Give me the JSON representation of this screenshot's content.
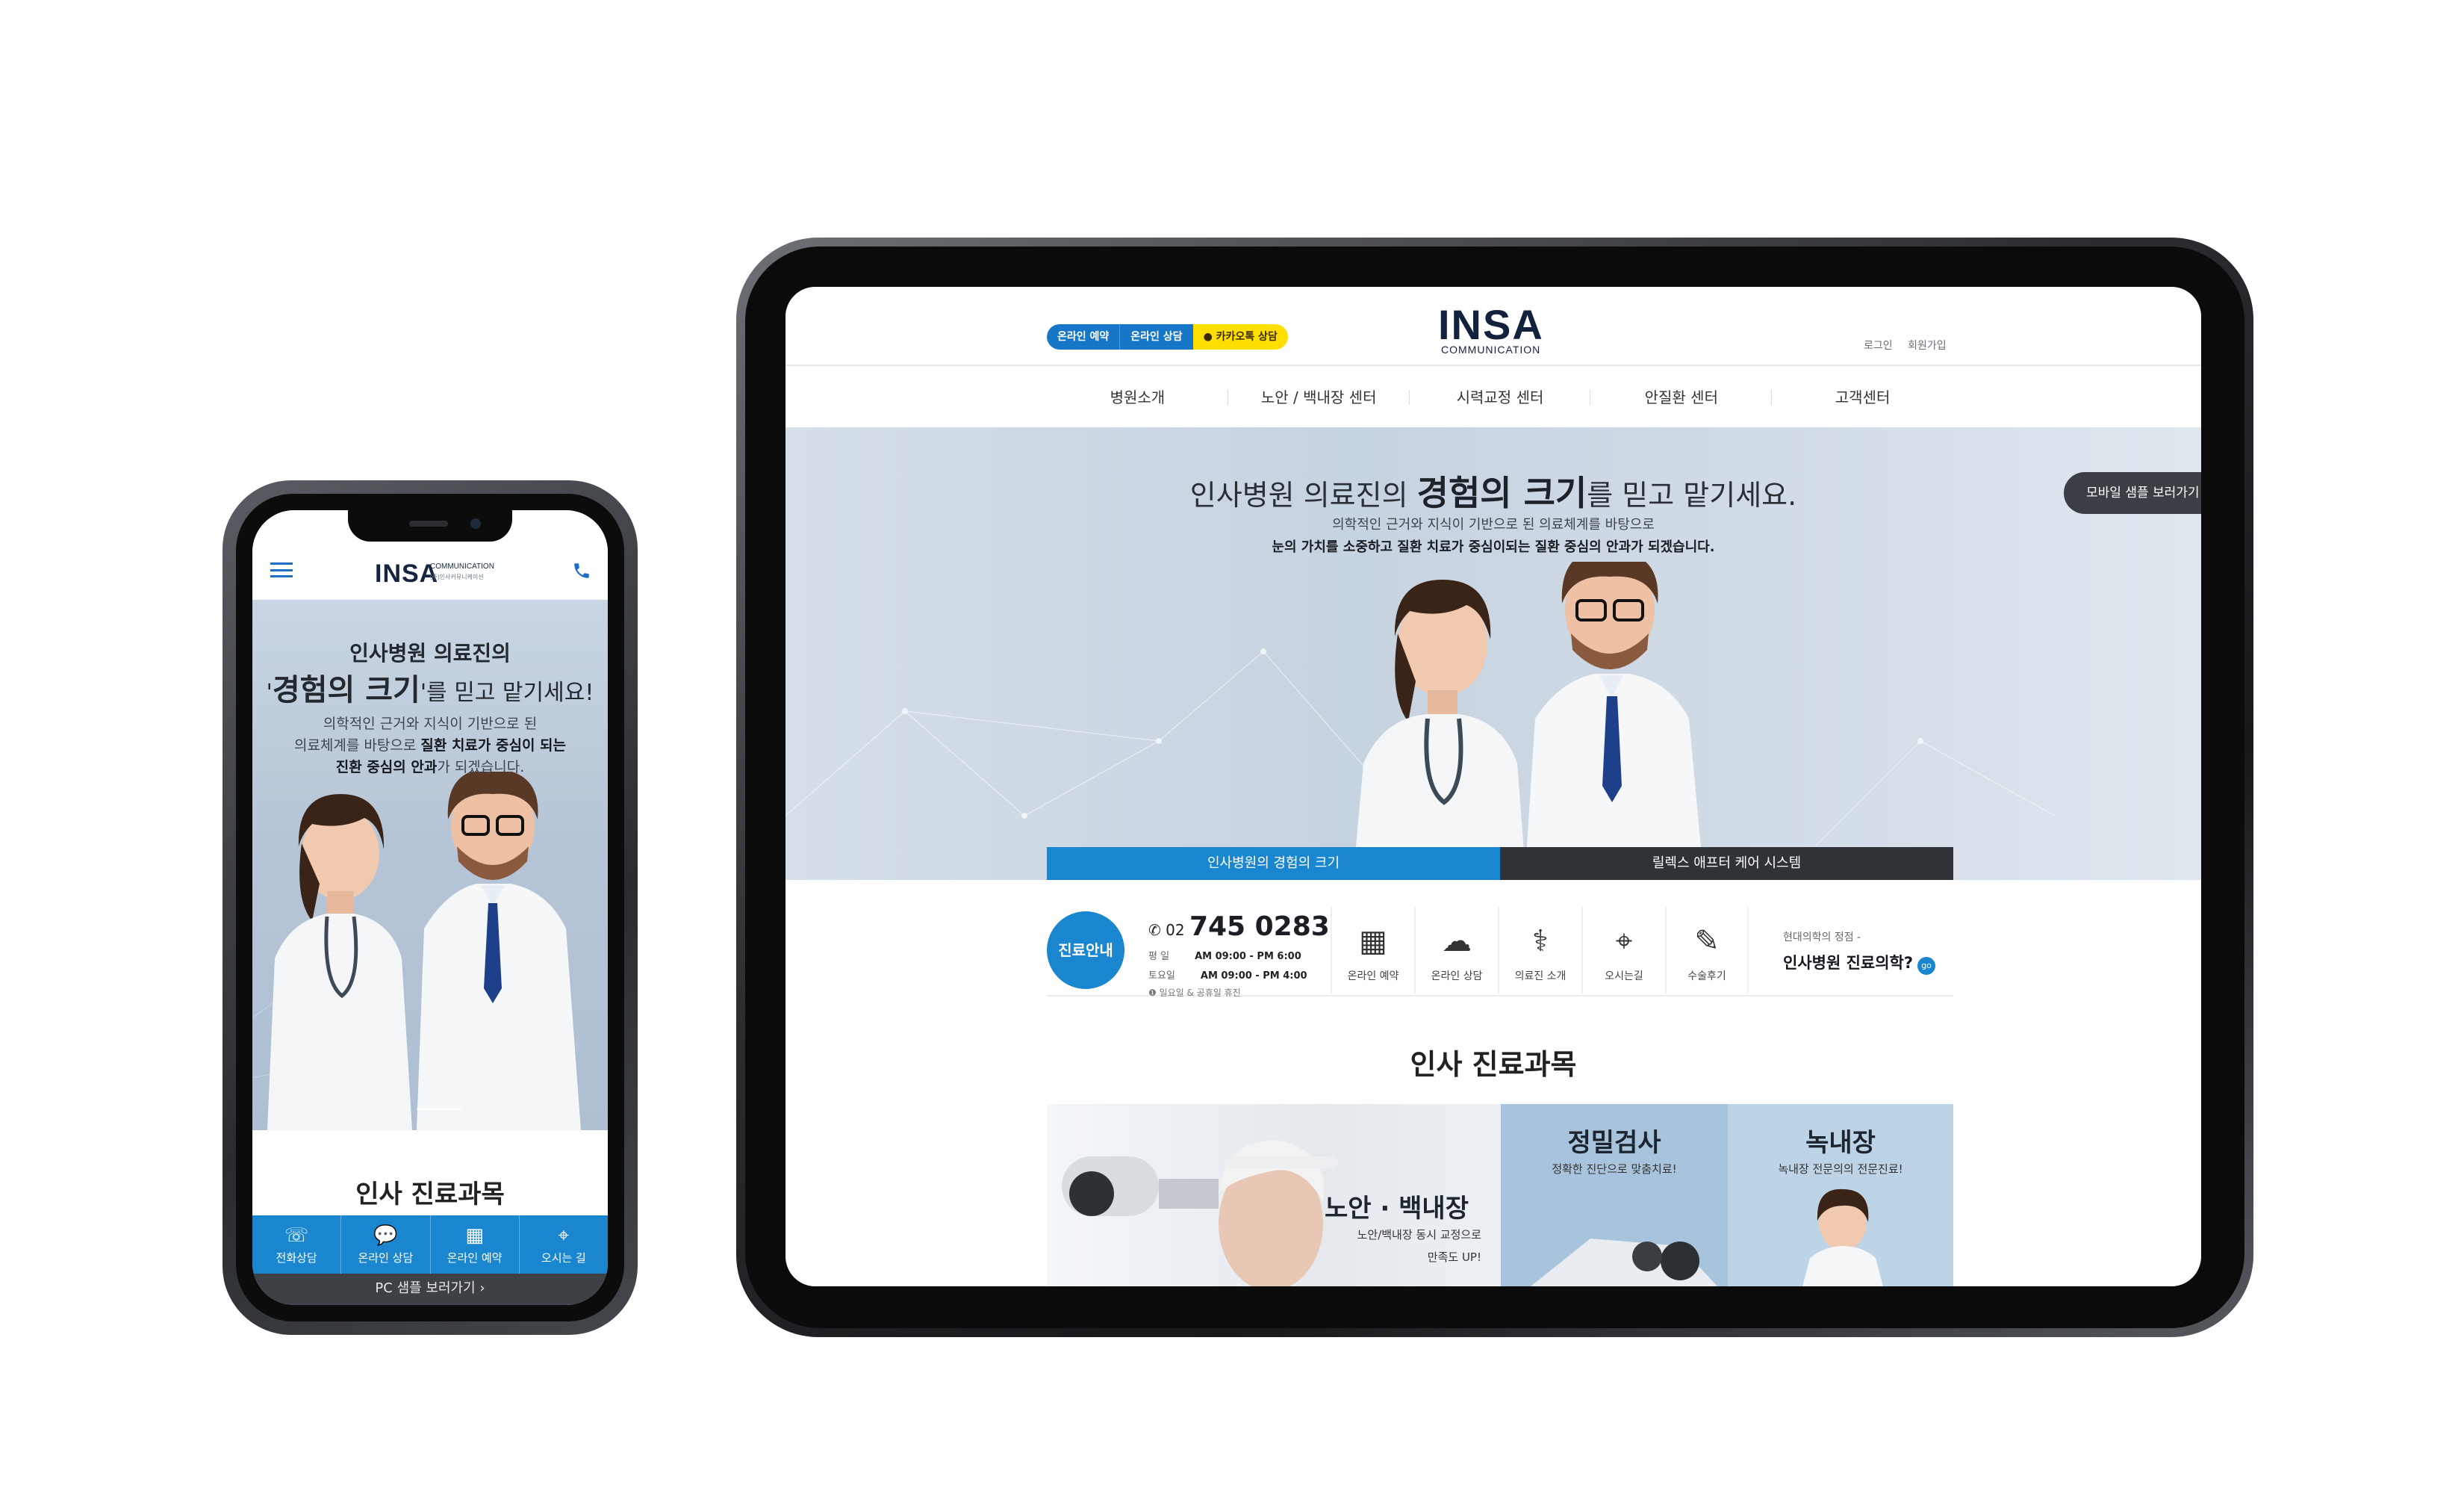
{
  "mobile": {
    "logo": "INSA",
    "logo_sub": "COMMUNICATION",
    "logo_sub2": "(주)인사커뮤니케이션",
    "hero": {
      "line1": "인사병원 의료진의",
      "line2_q1": "'",
      "line2_bold": "경험의 크기",
      "line2_rest": "'를 믿고 맡기세요!",
      "desc1": "의학적인 근거와 지식이 기반으로 된",
      "desc2_a": "의료체계를 바탕으로 ",
      "desc2_b": "질환 치료가 중심이 되는",
      "desc3_a": "진환 중심의 안과",
      "desc3_b": "가 되겠습니다."
    },
    "section_title": "인사 진료과목",
    "tabbar": [
      {
        "icon": "phone-icon",
        "label": "전화상담"
      },
      {
        "icon": "chat-icon",
        "label": "온라인 상담"
      },
      {
        "icon": "calendar-icon",
        "label": "온라인 예약"
      },
      {
        "icon": "location-icon",
        "label": "오시는 길"
      }
    ],
    "pc_link": "PC 샘플 보러가기  ›"
  },
  "tablet": {
    "quick": [
      "온라인 예약",
      "온라인 상담",
      "카카오톡 상담"
    ],
    "logo": "INSA",
    "logo_sub": "COMMUNICATION",
    "util": [
      "로그인",
      "회원가입"
    ],
    "nav": [
      "병원소개",
      "노안 / 백내장 센터",
      "시력교정 센터",
      "안질환 센터",
      "고객센터"
    ],
    "hero": {
      "title_a": "인사병원 의료진의 ",
      "title_bold": "경험의 크기",
      "title_b": "를 믿고 맡기세요.",
      "desc1": "의학적인 근거와 지식이 기반으로 된 의료체계를 바탕으로",
      "desc2": "눈의 가치를 소중하고 질환 치료가 중심이되는 질환 중심의 안과가 되겠습니다."
    },
    "mobile_btn": "모바일 샘플 보러가기",
    "slide_tabs": [
      "인사병원의 경험의 크기",
      "릴렉스 애프터 케어 시스템"
    ],
    "info": {
      "badge": "진료안내",
      "tel_prefix": "02",
      "tel_number": "745 0283",
      "hours": [
        {
          "day": "평    일",
          "time": "AM 09:00 - PM 6:00"
        },
        {
          "day": "토요일",
          "time": "AM 09:00 - PM 4:00"
        }
      ],
      "holiday": "일요일 & 공휴일 휴진",
      "links": [
        {
          "icon": "calendar-icon",
          "label": "온라인 예약"
        },
        {
          "icon": "chat-icon",
          "label": "온라인 상담"
        },
        {
          "icon": "stethoscope-icon",
          "label": "의료진 소개"
        },
        {
          "icon": "location-icon",
          "label": "오시는길"
        },
        {
          "icon": "review-icon",
          "label": "수술후기"
        }
      ],
      "extra_small": "현대의학의 정점 -",
      "extra_big": "인사병원 진료의학?",
      "go": "go"
    },
    "section_title": "인사 진료과목",
    "cards": [
      {
        "title": "노안 · 백내장",
        "sub1": "노안/백내장 동시 교정으로",
        "sub2": "만족도 UP!"
      },
      {
        "title": "정밀검사",
        "sub1": "정확한 진단으로 맞춤치료!"
      },
      {
        "title": "녹내장",
        "sub1": "녹내장 전문의의 전문진료!"
      }
    ]
  },
  "colors": {
    "accent": "#1a86d0",
    "dark": "#2f3237",
    "kakao": "#ffdf00"
  }
}
